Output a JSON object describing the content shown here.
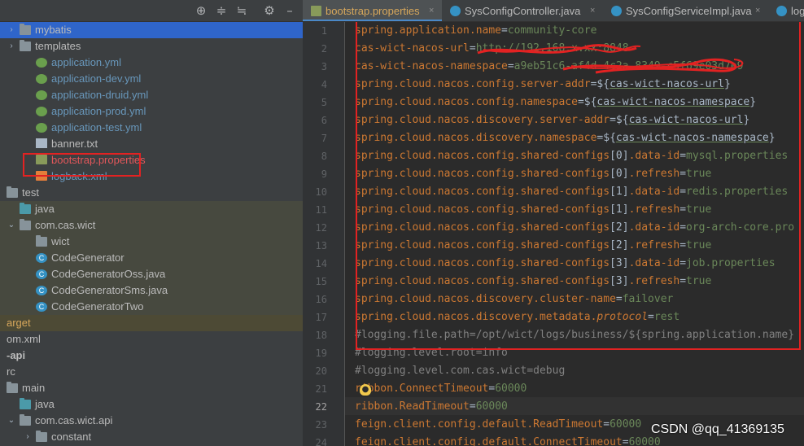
{
  "project_panel": {
    "toolbar_icons": [
      "locate-icon",
      "expand-all-icon",
      "collapse-all-icon",
      "settings-icon",
      "hide-icon"
    ],
    "tree": [
      {
        "label": "mybatis",
        "icon": "folder-icon",
        "arrow": "›"
      },
      {
        "label": "templates",
        "icon": "folder-icon",
        "arrow": "›"
      },
      {
        "label": "application.yml",
        "icon": "spring-leaf-icon"
      },
      {
        "label": "application-dev.yml",
        "icon": "spring-leaf-icon"
      },
      {
        "label": "application-druid.yml",
        "icon": "spring-leaf-icon"
      },
      {
        "label": "application-prod.yml",
        "icon": "spring-leaf-icon"
      },
      {
        "label": "application-test.yml",
        "icon": "spring-leaf-icon"
      },
      {
        "label": "banner.txt",
        "icon": "text-file-icon"
      },
      {
        "label": "bootstrap.properties",
        "icon": "properties-file-icon"
      },
      {
        "label": "logback.xml",
        "icon": "xml-file-icon"
      },
      {
        "label": "test",
        "icon": "folder-icon",
        "arrow": "⌄"
      },
      {
        "label": "java",
        "icon": "source-folder-icon"
      },
      {
        "label": "com.cas.wict",
        "icon": "package-icon",
        "arrow": "⌄"
      },
      {
        "label": "wict",
        "icon": "package-icon"
      },
      {
        "label": "CodeGenerator",
        "icon": "class-icon"
      },
      {
        "label": "CodeGeneratorOss.java",
        "icon": "java-file-icon"
      },
      {
        "label": "CodeGeneratorSms.java",
        "icon": "java-file-icon"
      },
      {
        "label": "CodeGeneratorTwo",
        "icon": "class-icon"
      },
      {
        "label": "arget",
        "icon": "none"
      },
      {
        "label": "om.xml",
        "icon": "none"
      },
      {
        "label": "-api",
        "icon": "none"
      },
      {
        "label": "rc",
        "icon": "none"
      },
      {
        "label": "main",
        "icon": "folder-icon",
        "arrow": "⌄"
      },
      {
        "label": "java",
        "icon": "source-folder-icon"
      },
      {
        "label": "com.cas.wict.api",
        "icon": "package-icon",
        "arrow": "⌄"
      },
      {
        "label": "constant",
        "icon": "package-icon",
        "arrow": "›"
      }
    ]
  },
  "tabs": [
    {
      "label": "bootstrap.properties",
      "active": true
    },
    {
      "label": "SysConfigController.java",
      "active": false
    },
    {
      "label": "SysConfigServiceImpl.java",
      "active": false
    },
    {
      "label": "logb",
      "active": false
    }
  ],
  "editor": {
    "current_line": 22,
    "lines": [
      [
        {
          "t": "spring.application.name",
          "c": "k"
        },
        {
          "t": "=",
          "c": "eq"
        },
        {
          "t": "community-core",
          "c": "v"
        }
      ],
      [
        {
          "t": "cas-wict-nacos-url",
          "c": "k"
        },
        {
          "t": "=",
          "c": "eq"
        },
        {
          "t": "http://192.168.x.xx:8848",
          "c": "v"
        }
      ],
      [
        {
          "t": "cas-wict-nacos-namespace",
          "c": "k"
        },
        {
          "t": "=",
          "c": "eq"
        },
        {
          "t": "a9eb51c6-af4d-4c2a-8349-c5f69e03d7e9",
          "c": "v"
        }
      ],
      [
        {
          "t": "spring.cloud.nacos.config.server-addr",
          "c": "k"
        },
        {
          "t": "=${",
          "c": "eq"
        },
        {
          "t": "cas-wict-nacos-url",
          "c": "ref"
        },
        {
          "t": "}",
          "c": "br"
        }
      ],
      [
        {
          "t": "spring.cloud.nacos.config.namespace",
          "c": "k"
        },
        {
          "t": "=${",
          "c": "eq"
        },
        {
          "t": "cas-wict-nacos-namespace",
          "c": "ref"
        },
        {
          "t": "}",
          "c": "br"
        }
      ],
      [
        {
          "t": "spring.cloud.nacos.discovery.server-addr",
          "c": "k"
        },
        {
          "t": "=${",
          "c": "eq"
        },
        {
          "t": "cas-wict-nacos-url",
          "c": "ref"
        },
        {
          "t": "}",
          "c": "br"
        }
      ],
      [
        {
          "t": "spring.cloud.nacos.discovery.namespace",
          "c": "k"
        },
        {
          "t": "=${",
          "c": "eq"
        },
        {
          "t": "cas-wict-nacos-namespace",
          "c": "ref"
        },
        {
          "t": "}",
          "c": "br"
        }
      ],
      [
        {
          "t": "spring.cloud.nacos.config.shared-configs",
          "c": "k"
        },
        {
          "t": "[0]",
          "c": "eq"
        },
        {
          "t": ".data-id",
          "c": "k"
        },
        {
          "t": "=",
          "c": "eq"
        },
        {
          "t": "mysql.properties",
          "c": "v"
        }
      ],
      [
        {
          "t": "spring.cloud.nacos.config.shared-configs",
          "c": "k"
        },
        {
          "t": "[0]",
          "c": "eq"
        },
        {
          "t": ".refresh",
          "c": "k"
        },
        {
          "t": "=",
          "c": "eq"
        },
        {
          "t": "true",
          "c": "v"
        }
      ],
      [
        {
          "t": "spring.cloud.nacos.config.shared-configs",
          "c": "k"
        },
        {
          "t": "[1]",
          "c": "eq"
        },
        {
          "t": ".data-id",
          "c": "k"
        },
        {
          "t": "=",
          "c": "eq"
        },
        {
          "t": "redis.properties",
          "c": "v"
        }
      ],
      [
        {
          "t": "spring.cloud.nacos.config.shared-configs",
          "c": "k"
        },
        {
          "t": "[1]",
          "c": "eq"
        },
        {
          "t": ".refresh",
          "c": "k"
        },
        {
          "t": "=",
          "c": "eq"
        },
        {
          "t": "true",
          "c": "v"
        }
      ],
      [
        {
          "t": "spring.cloud.nacos.config.shared-configs",
          "c": "k"
        },
        {
          "t": "[2]",
          "c": "eq"
        },
        {
          "t": ".data-id",
          "c": "k"
        },
        {
          "t": "=",
          "c": "eq"
        },
        {
          "t": "org-arch-core.pro",
          "c": "v"
        }
      ],
      [
        {
          "t": "spring.cloud.nacos.config.shared-configs",
          "c": "k"
        },
        {
          "t": "[2]",
          "c": "eq"
        },
        {
          "t": ".refresh",
          "c": "k"
        },
        {
          "t": "=",
          "c": "eq"
        },
        {
          "t": "true",
          "c": "v"
        }
      ],
      [
        {
          "t": "spring.cloud.nacos.config.shared-configs",
          "c": "k"
        },
        {
          "t": "[3]",
          "c": "eq"
        },
        {
          "t": ".data-id",
          "c": "k"
        },
        {
          "t": "=",
          "c": "eq"
        },
        {
          "t": "job.properties",
          "c": "v"
        }
      ],
      [
        {
          "t": "spring.cloud.nacos.config.shared-configs",
          "c": "k"
        },
        {
          "t": "[3]",
          "c": "eq"
        },
        {
          "t": ".refresh",
          "c": "k"
        },
        {
          "t": "=",
          "c": "eq"
        },
        {
          "t": "true",
          "c": "v"
        }
      ],
      [
        {
          "t": "spring.cloud.nacos.discovery.cluster-name",
          "c": "k"
        },
        {
          "t": "=",
          "c": "eq"
        },
        {
          "t": "failover",
          "c": "v"
        }
      ],
      [
        {
          "t": "spring.cloud.nacos.discovery.metadata.",
          "c": "k"
        },
        {
          "t": "protocol",
          "c": "k it"
        },
        {
          "t": "=",
          "c": "eq"
        },
        {
          "t": "rest",
          "c": "v"
        }
      ],
      [
        {
          "t": "#logging.file.path=/opt/wict/logs/business/${spring.application.name}",
          "c": "cm"
        }
      ],
      [
        {
          "t": "#logging.level.root=info",
          "c": "cm"
        }
      ],
      [
        {
          "t": "#logging.level.com.cas.wict=debug",
          "c": "cm"
        }
      ],
      [
        {
          "t": "ribbon.ConnectTimeout",
          "c": "k"
        },
        {
          "t": "=",
          "c": "eq"
        },
        {
          "t": "60000",
          "c": "v"
        }
      ],
      [
        {
          "t": "ribbon.ReadTimeout",
          "c": "k"
        },
        {
          "t": "=",
          "c": "eq"
        },
        {
          "t": "60000",
          "c": "v"
        }
      ],
      [
        {
          "t": "feign.client.config.default.ReadTimeout",
          "c": "k"
        },
        {
          "t": "=",
          "c": "eq"
        },
        {
          "t": "60000",
          "c": "v"
        }
      ],
      [
        {
          "t": "feign.client.config.default.ConnectTimeout",
          "c": "k"
        },
        {
          "t": "=",
          "c": "eq"
        },
        {
          "t": "60000",
          "c": "v"
        }
      ]
    ]
  },
  "watermark": "CSDN @qq_41369135",
  "colors": {
    "annotation_red": "#e32222",
    "key": "#cc7832",
    "value": "#6a8759",
    "comment": "#808080"
  }
}
